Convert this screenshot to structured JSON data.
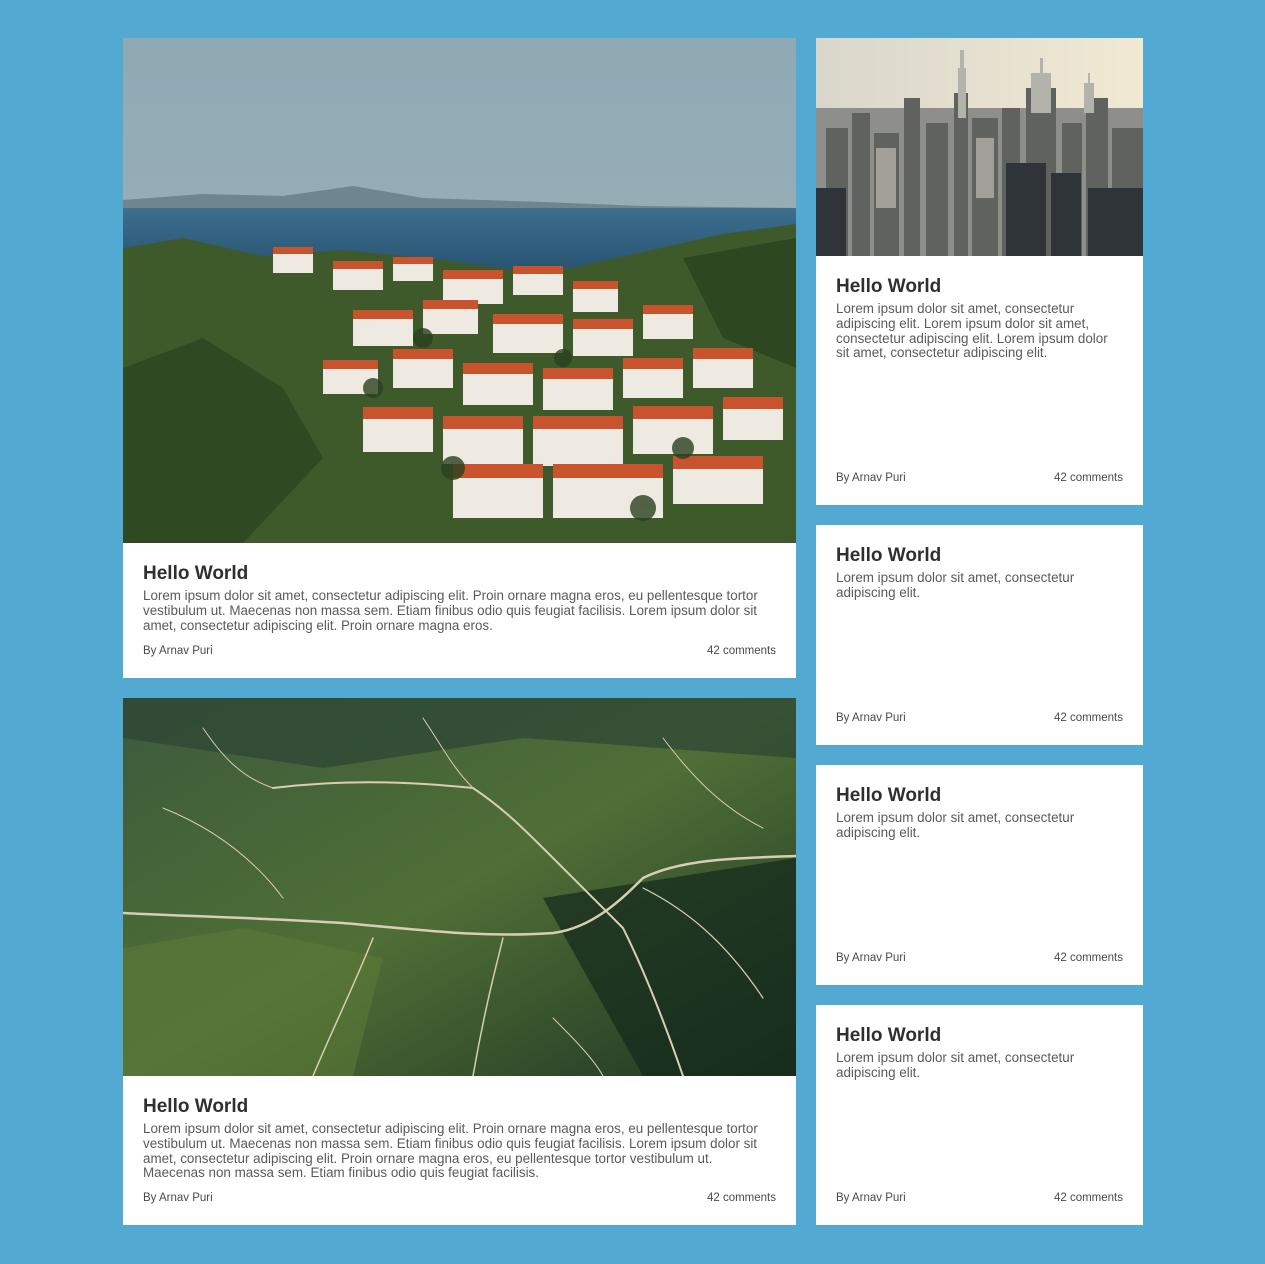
{
  "colors": {
    "background": "#52a9d1",
    "card": "#ffffff",
    "title": "#2f2f2f",
    "text": "#5a5a5a"
  },
  "cards": [
    {
      "image": "coastal-town-photo",
      "title": "Hello World",
      "text": "Lorem ipsum dolor sit amet, consectetur adipiscing elit. Proin ornare magna eros, eu pellentesque tortor vestibulum ut. Maecenas non massa sem. Etiam finibus odio quis feugiat facilisis. Lorem ipsum dolor sit amet, consectetur adipiscing elit. Proin ornare magna eros.",
      "author": "By Arnav Puri",
      "comments": "42 comments"
    },
    {
      "image": "city-skyline-photo",
      "title": "Hello World",
      "text": "Lorem ipsum dolor sit amet, consectetur adipiscing elit. Lorem ipsum dolor sit amet, consectetur adipiscing elit. Lorem ipsum dolor sit amet, consectetur adipiscing elit.",
      "author": "By Arnav Puri",
      "comments": "42 comments"
    },
    {
      "title": "Hello World",
      "text": "Lorem ipsum dolor sit amet, consectetur adipiscing elit.",
      "author": "By Arnav Puri",
      "comments": "42 comments"
    },
    {
      "image": "aerial-landscape-photo",
      "title": "Hello World",
      "text": "Lorem ipsum dolor sit amet, consectetur adipiscing elit. Proin ornare magna eros, eu pellentesque tortor vestibulum ut. Maecenas non massa sem. Etiam finibus odio quis feugiat facilisis. Lorem ipsum dolor sit amet, consectetur adipiscing elit. Proin ornare magna eros, eu pellentesque tortor vestibulum ut. Maecenas non massa sem. Etiam finibus odio quis feugiat facilisis.",
      "author": "By Arnav Puri",
      "comments": "42 comments"
    },
    {
      "title": "Hello World",
      "text": "Lorem ipsum dolor sit amet, consectetur adipiscing elit.",
      "author": "By Arnav Puri",
      "comments": "42 comments"
    },
    {
      "title": "Hello World",
      "text": "Lorem ipsum dolor sit amet, consectetur adipiscing elit.",
      "author": "By Arnav Puri",
      "comments": "42 comments"
    }
  ]
}
